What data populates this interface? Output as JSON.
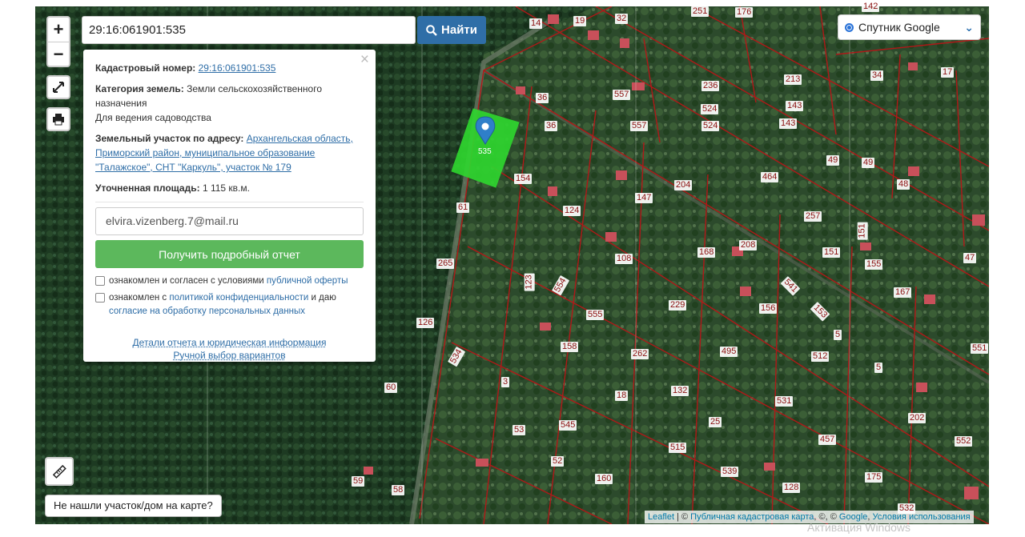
{
  "search": {
    "value": "29:16:061901:535",
    "button_label": "Найти"
  },
  "zoom": {
    "in_label": "+",
    "out_label": "−"
  },
  "tools": {
    "fullscreen_icon": "fullscreen-icon",
    "print_icon": "printer-icon",
    "ruler_icon": "ruler-icon"
  },
  "layer": {
    "selected": "Спутник Google"
  },
  "popup": {
    "cadastral_label": "Кадастровый номер:",
    "cadastral_value": "29:16:061901:535",
    "category_label": "Категория земель:",
    "category_value_1": "Земли сельскохозяйственного назначения",
    "category_value_2": "Для ведения садоводства",
    "address_label": "Земельный участок по адресу:",
    "address_value": "Архангельская область, Приморский район, муниципальное образование \"Талажское\", СНТ \"Каркуль\", участок № 179",
    "area_label": "Уточненная площадь:",
    "area_value": "1 115 кв.м.",
    "email_value": "elvira.vizenberg.7@mail.ru",
    "report_button": "Получить подробный отчет",
    "check1_prefix": "ознакомлен и согласен с условиями",
    "check1_link": "публичной оферты",
    "check2_prefix": "ознакомлен с",
    "check2_link": "политикой конфиденциальности",
    "check2_mid": "и даю",
    "check2_link2": "согласие на обработку персональных данных",
    "link_details": "Детали отчета и юридическая информация",
    "link_manual": "Ручной выбор вариантов",
    "close": "×"
  },
  "not_found": "Не нашли участок/дом на карте?",
  "marker_label": "535",
  "attribution": {
    "leaflet": "Leaflet",
    "sep1": " | © ",
    "pkk": "Публичная кадастровая карта",
    "sep2": ", ©, © ",
    "google": "Google",
    "sep3": ", ",
    "terms": "Условия использования"
  },
  "watermark": "Активация Windows",
  "map_labels": [
    "14",
    "19",
    "32",
    "251",
    "176",
    "142",
    "236",
    "213",
    "34",
    "17",
    "36",
    "557",
    "524",
    "143",
    "36",
    "557",
    "524",
    "143",
    "49",
    "49",
    "154",
    "464",
    "204",
    "147",
    "48",
    "124",
    "61",
    "257",
    "208",
    "151",
    "108",
    "168",
    "151",
    "155",
    "47",
    "265",
    "123",
    "554",
    "229",
    "156",
    "541",
    "167",
    "153",
    "555",
    "126",
    "158",
    "262",
    "495",
    "512",
    "5",
    "551",
    "534",
    "3",
    "60",
    "18",
    "132",
    "531",
    "5",
    "202",
    "53",
    "545",
    "25",
    "457",
    "552",
    "52",
    "515",
    "539",
    "160",
    "175",
    "59",
    "58",
    "128",
    "532"
  ],
  "colors": {
    "parcel": "#b01818",
    "selected": "#2fd52f",
    "marker": "#2f7fc9"
  }
}
